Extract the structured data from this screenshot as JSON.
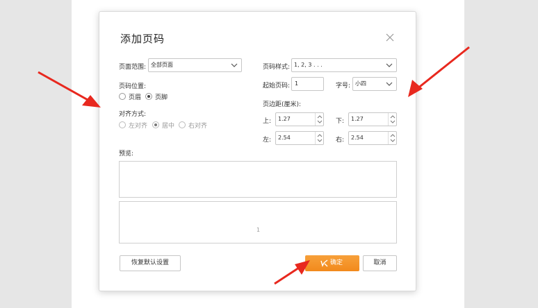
{
  "dialog": {
    "title": "添加页码",
    "close_icon": "close-icon"
  },
  "page_range": {
    "label": "页面范围:",
    "value": "全部页面"
  },
  "page_position": {
    "label": "页码位置:",
    "options": [
      "页眉",
      "页脚"
    ],
    "selected": "页脚"
  },
  "alignment": {
    "label": "对齐方式:",
    "options": [
      "左对齐",
      "居中",
      "右对齐"
    ],
    "selected": "居中"
  },
  "number_style": {
    "label": "页码样式:",
    "value": "1, 2, 3 . . ."
  },
  "start_page": {
    "label": "起始页码:",
    "value": "1"
  },
  "font_size": {
    "label": "字号:",
    "value": "小四"
  },
  "margins": {
    "label": "页边距(厘米):",
    "top_label": "上:",
    "top": "1.27",
    "bottom_label": "下:",
    "bottom": "1.27",
    "left_label": "左:",
    "left": "2.54",
    "right_label": "右:",
    "right": "2.54"
  },
  "preview": {
    "label": "预览:",
    "page_number": "1"
  },
  "buttons": {
    "restore": "恢复默认设置",
    "ok": "确定",
    "cancel": "取消"
  },
  "colors": {
    "ok_button": "#f28a1c",
    "annotation_arrow": "#e8281e"
  }
}
